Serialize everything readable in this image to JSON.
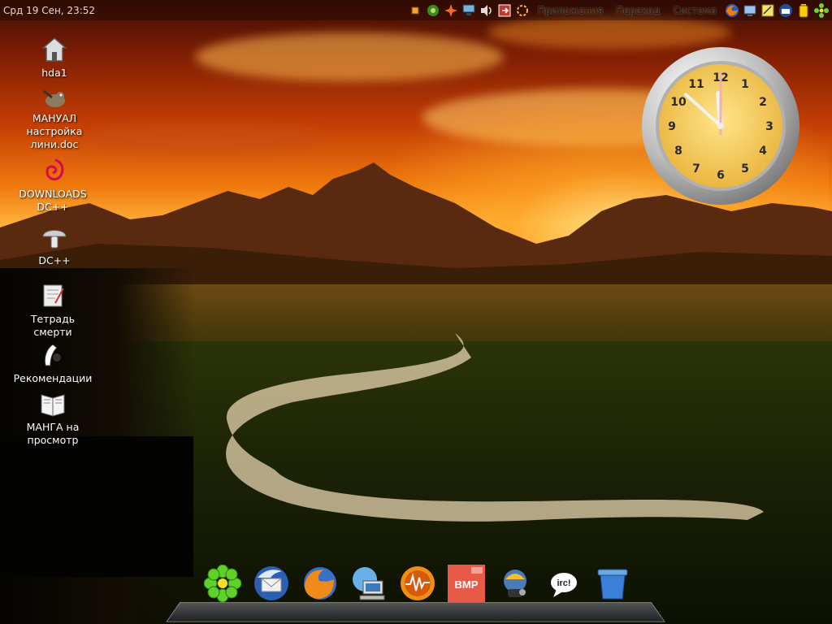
{
  "top_panel": {
    "datetime": "Срд 19 Сен, 23:52",
    "menus": [
      "Приложения",
      "Переход",
      "Система"
    ],
    "tray_icons": [
      "notification-icon",
      "network-flower-icon",
      "star-burst-icon",
      "network-icon",
      "volume-icon",
      "logout-icon",
      "update-icon"
    ],
    "launcher_icons": [
      "firefox-icon",
      "screen-icon",
      "notes-icon",
      "thunderbird-icon",
      "battery-icon",
      "icq-icon"
    ]
  },
  "desktop_icons": [
    {
      "icon": "home-drive-icon",
      "label": "hda1"
    },
    {
      "icon": "gimp-icon",
      "label": "МАНУАЛ настройка лини.doc"
    },
    {
      "icon": "debian-swirl-icon",
      "label": "DOWNLOADS DC++"
    },
    {
      "icon": "mushroom-icon",
      "label": "DC++"
    },
    {
      "icon": "notebook-icon",
      "label": "Тетрадь смерти"
    },
    {
      "icon": "recommend-icon",
      "label": "Рекомендации"
    },
    {
      "icon": "manga-book-icon",
      "label": "МАНГА на просмотр"
    }
  ],
  "clock": {
    "numbers": [
      "12",
      "1",
      "2",
      "3",
      "4",
      "5",
      "6",
      "7",
      "8",
      "9",
      "10",
      "11"
    ],
    "hour": 23,
    "minute": 52,
    "face_color": "#f2c24a",
    "rim_color": "#d9d9d9"
  },
  "dock": {
    "items": [
      "icq-icon",
      "thunderbird-icon",
      "firefox-icon",
      "network-browser-icon",
      "audio-player-icon",
      "bmp-icon",
      "jabber-icon",
      "irc-icon",
      "trash-icon"
    ],
    "bmp_label": "BMP",
    "irc_label": "irc!"
  }
}
